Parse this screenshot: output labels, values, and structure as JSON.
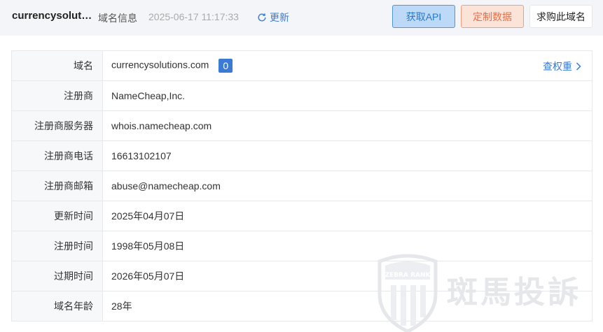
{
  "header": {
    "domain_title": "currencysolutions.com",
    "subtitle": "域名信息",
    "timestamp": "2025-06-17 11:17:33",
    "refresh_label": "更新",
    "buttons": {
      "api": "获取API",
      "custom": "定制数据",
      "buy": "求购此域名"
    }
  },
  "rows": [
    {
      "label": "域名",
      "value": "currencysolutions.com",
      "badge": "0",
      "action": "查权重"
    },
    {
      "label": "注册商",
      "value": "NameCheap,Inc."
    },
    {
      "label": "注册商服务器",
      "value": "whois.namecheap.com"
    },
    {
      "label": "注册商电话",
      "value": "16613102107"
    },
    {
      "label": "注册商邮箱",
      "value": "abuse@namecheap.com"
    },
    {
      "label": "更新时间",
      "value": "2025年04月07日"
    },
    {
      "label": "注册时间",
      "value": "1998年05月08日"
    },
    {
      "label": "过期时间",
      "value": "2026年05月07日"
    },
    {
      "label": "域名年龄",
      "value": "28年"
    }
  ],
  "watermark": {
    "text": "斑馬投訴",
    "logo_text": "ZEBRA RANK"
  },
  "colors": {
    "accent": "#3a7bd5",
    "api_bg": "#bcdaf7",
    "custom_bg": "#fbe3d8",
    "custom_text": "#e5714a"
  }
}
